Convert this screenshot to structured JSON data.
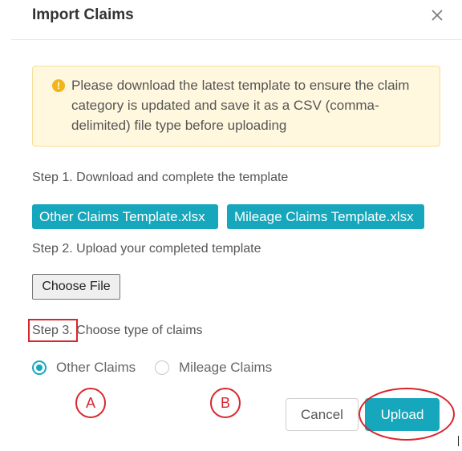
{
  "dialog": {
    "title": "Import Claims",
    "close_icon": "close-icon"
  },
  "alert": {
    "icon": "exclamation-icon",
    "text": "Please download the latest template to ensure the claim category is updated and save it as a CSV (comma-delimited) file type before uploading"
  },
  "steps": {
    "step1": "Step 1. Download and complete the template",
    "step2": "Step 2. Upload your completed template",
    "step3": "Step 3. Choose type of claims"
  },
  "templates": {
    "other_label": "Other Claims Template.xlsx",
    "mileage_label": "Mileage Claims Template.xlsx"
  },
  "file_input": {
    "button_label": "Choose File"
  },
  "claim_type": {
    "options": [
      "Other Claims",
      "Mileage Claims"
    ],
    "selected": "Other Claims"
  },
  "annotations": {
    "marker_a": "A",
    "marker_b": "B"
  },
  "actions": {
    "cancel_label": "Cancel",
    "upload_label": "Upload"
  },
  "colors": {
    "accent": "#17a7bd",
    "alert_background": "#fff7de",
    "alert_icon": "#f2b517",
    "annotation_red": "#d9262c"
  }
}
